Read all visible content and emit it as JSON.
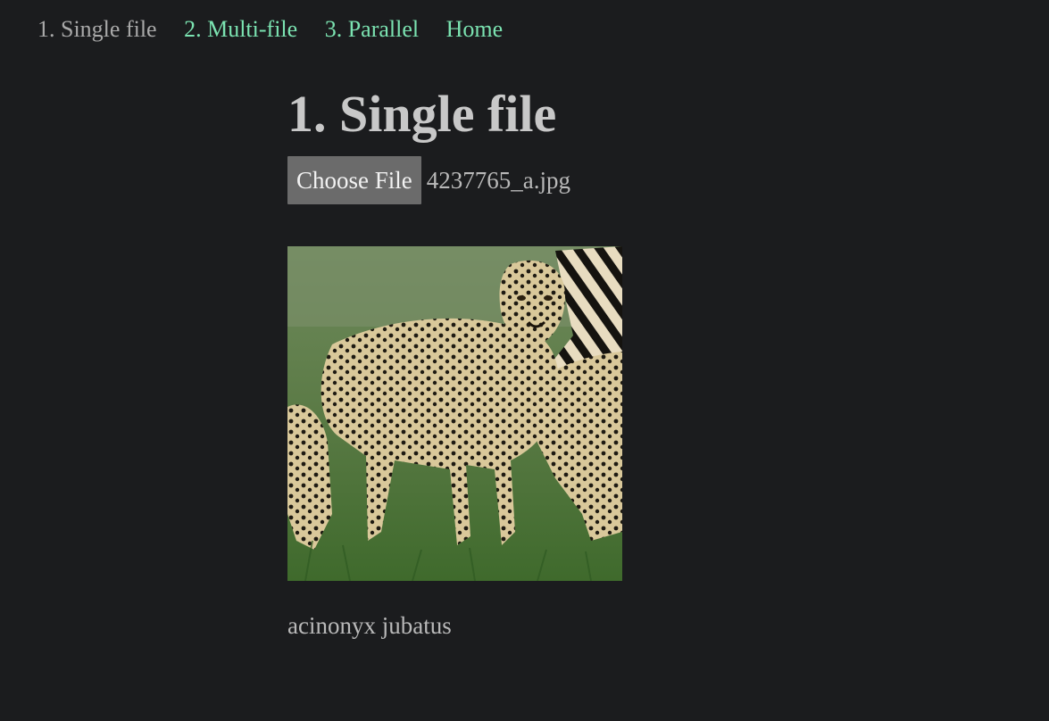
{
  "nav": {
    "items": [
      {
        "label": "1. Single file",
        "current": true
      },
      {
        "label": "2. Multi-file",
        "current": false
      },
      {
        "label": "3. Parallel",
        "current": false
      },
      {
        "label": "Home",
        "current": false
      }
    ]
  },
  "page": {
    "title": "1. Single file"
  },
  "file_input": {
    "button_label": "Choose File",
    "selected_file": "4237765_a.jpg"
  },
  "result": {
    "label": "acinonyx jubatus"
  },
  "colors": {
    "background": "#1b1c1e",
    "link": "#7be3b1",
    "current_link": "#a9a9a9",
    "text": "#c4c4c4",
    "button_bg": "#6b6b6b"
  }
}
